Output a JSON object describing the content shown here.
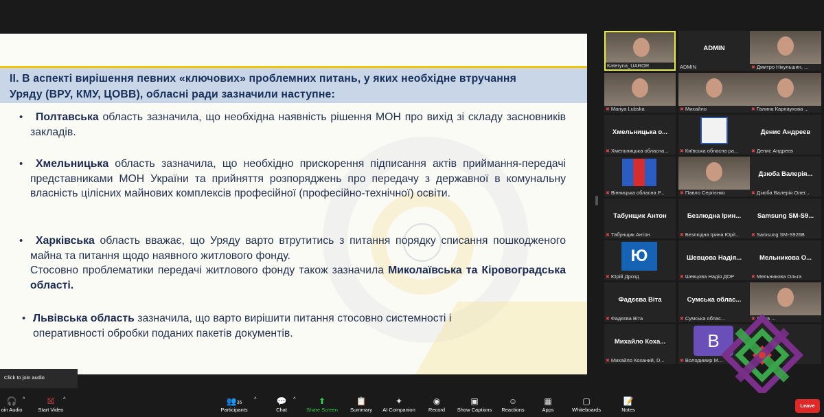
{
  "slide": {
    "heading_line1": "ІІ. В аспекті вирішення певних «ключових» проблемних питань, у яких необхідне втручання",
    "heading_line2": "Уряду (ВРУ, КМУ, ЦОВВ), обласні ради зазначили наступне:",
    "bullets": [
      {
        "bold": "Полтавська",
        "text": " область зазначила, що необхідна наявність рішення МОН про вихід зі складу засновників закладів."
      },
      {
        "bold": "Хмельницька",
        "text": " область зазначила, що необхідно прискорення підписання актів приймання-передачі представниками МОН України та прийняття розпоряджень про передачу з державної в комунальну власність цілісних майнових комплексів професійної (професійно-технічної) освіти."
      },
      {
        "bold": "Харківська",
        "text": " область вважає, що Уряду варто втрутитись з питання порядку списання пошкодженого майна та питання щодо наявного житлового фонду.",
        "extra_plain": "Стосовно проблематики передачі житлового фонду також зазначила ",
        "extra_bold": "Миколаївська та Кіровоградська області."
      },
      {
        "bold": "Львівська область",
        "text": " зазначила, що варто вирішити питання стосовно системності і оперативності обробки поданих пакетів документів."
      }
    ]
  },
  "participants": [
    {
      "center": "",
      "label": "Kateryna_UAROR",
      "muted": false,
      "active": true,
      "kind": "cam"
    },
    {
      "center": "ADMIN",
      "label": "ADMIN",
      "muted": false,
      "kind": "name"
    },
    {
      "center": "",
      "label": "Дмитро Нікульшин, ...",
      "muted": true,
      "kind": "cam"
    },
    {
      "center": "",
      "label": "Mariya Lubska",
      "muted": true,
      "kind": "cam"
    },
    {
      "center": "",
      "label": "Михайло",
      "muted": true,
      "kind": "cam"
    },
    {
      "center": "",
      "label": "Галина Карнаухова ...",
      "muted": true,
      "kind": "cam"
    },
    {
      "center": "Хмельницька о...",
      "label": "Хмельницька обласна...",
      "muted": true,
      "kind": "name"
    },
    {
      "center": "",
      "label": "Київська обласна ра...",
      "muted": true,
      "kind": "crest"
    },
    {
      "center": "Денис Андреєв",
      "label": "Денис Андреєв",
      "muted": true,
      "kind": "name"
    },
    {
      "center": "",
      "label": "Вінницька обласна Р...",
      "muted": true,
      "kind": "flag"
    },
    {
      "center": "",
      "label": "Павло Сергієнко",
      "muted": true,
      "kind": "cam"
    },
    {
      "center": "Дзюба Валерія...",
      "label": "Дзюба Валерія Олег...",
      "muted": true,
      "kind": "name"
    },
    {
      "center": "Табунщик Антон",
      "label": "Табунщик Антон",
      "muted": true,
      "kind": "name"
    },
    {
      "center": "Безлюдна Ірин...",
      "label": "Безлюдна Ірина Юрії...",
      "muted": true,
      "kind": "name"
    },
    {
      "center": "Samsung SM-S9...",
      "label": "Samsung SM-S926B",
      "muted": true,
      "kind": "name"
    },
    {
      "center": "Ю",
      "label": "Юрій Дрозд",
      "muted": true,
      "kind": "ju"
    },
    {
      "center": "Шевцова Надія...",
      "label": "Шевцова Надія ДОР",
      "muted": true,
      "kind": "name"
    },
    {
      "center": "Мельникова О...",
      "label": "Мельникова Ольга",
      "muted": true,
      "kind": "name"
    },
    {
      "center": "Фадєєва Віта",
      "label": "Фадєєва Віта",
      "muted": true,
      "kind": "name"
    },
    {
      "center": "Сумська облас...",
      "label": "Сумська облас...",
      "muted": true,
      "kind": "name"
    },
    {
      "center": "",
      "label": "Діана ...",
      "muted": true,
      "kind": "cam"
    },
    {
      "center": "Михайло Коха...",
      "label": "Михайло Коханий, D...",
      "muted": true,
      "kind": "name"
    },
    {
      "center": "В",
      "label": "Володимир М...",
      "muted": true,
      "kind": "v"
    },
    {
      "center": "",
      "label": "",
      "muted": true,
      "kind": "name"
    }
  ],
  "audio_tip": "Click to join audio",
  "toolbar": {
    "join_audio": "oin Audio",
    "start_video": "Start Video",
    "participants": "Participants",
    "participants_count": "35",
    "chat": "Chat",
    "share_screen": "Share Screen",
    "summary": "Summary",
    "ai_companion": "AI Companion",
    "record": "Record",
    "show_captions": "Show Captions",
    "reactions": "Reactions",
    "apps": "Apps",
    "whiteboards": "Whiteboards",
    "notes": "Notes",
    "leave": "Leave"
  },
  "colors": {
    "accent_green": "#2fd04a",
    "leave_red": "#e02828",
    "heading_bg": "#c9d6e8",
    "heading_text": "#17305a",
    "active_border": "#e6ee3b"
  }
}
